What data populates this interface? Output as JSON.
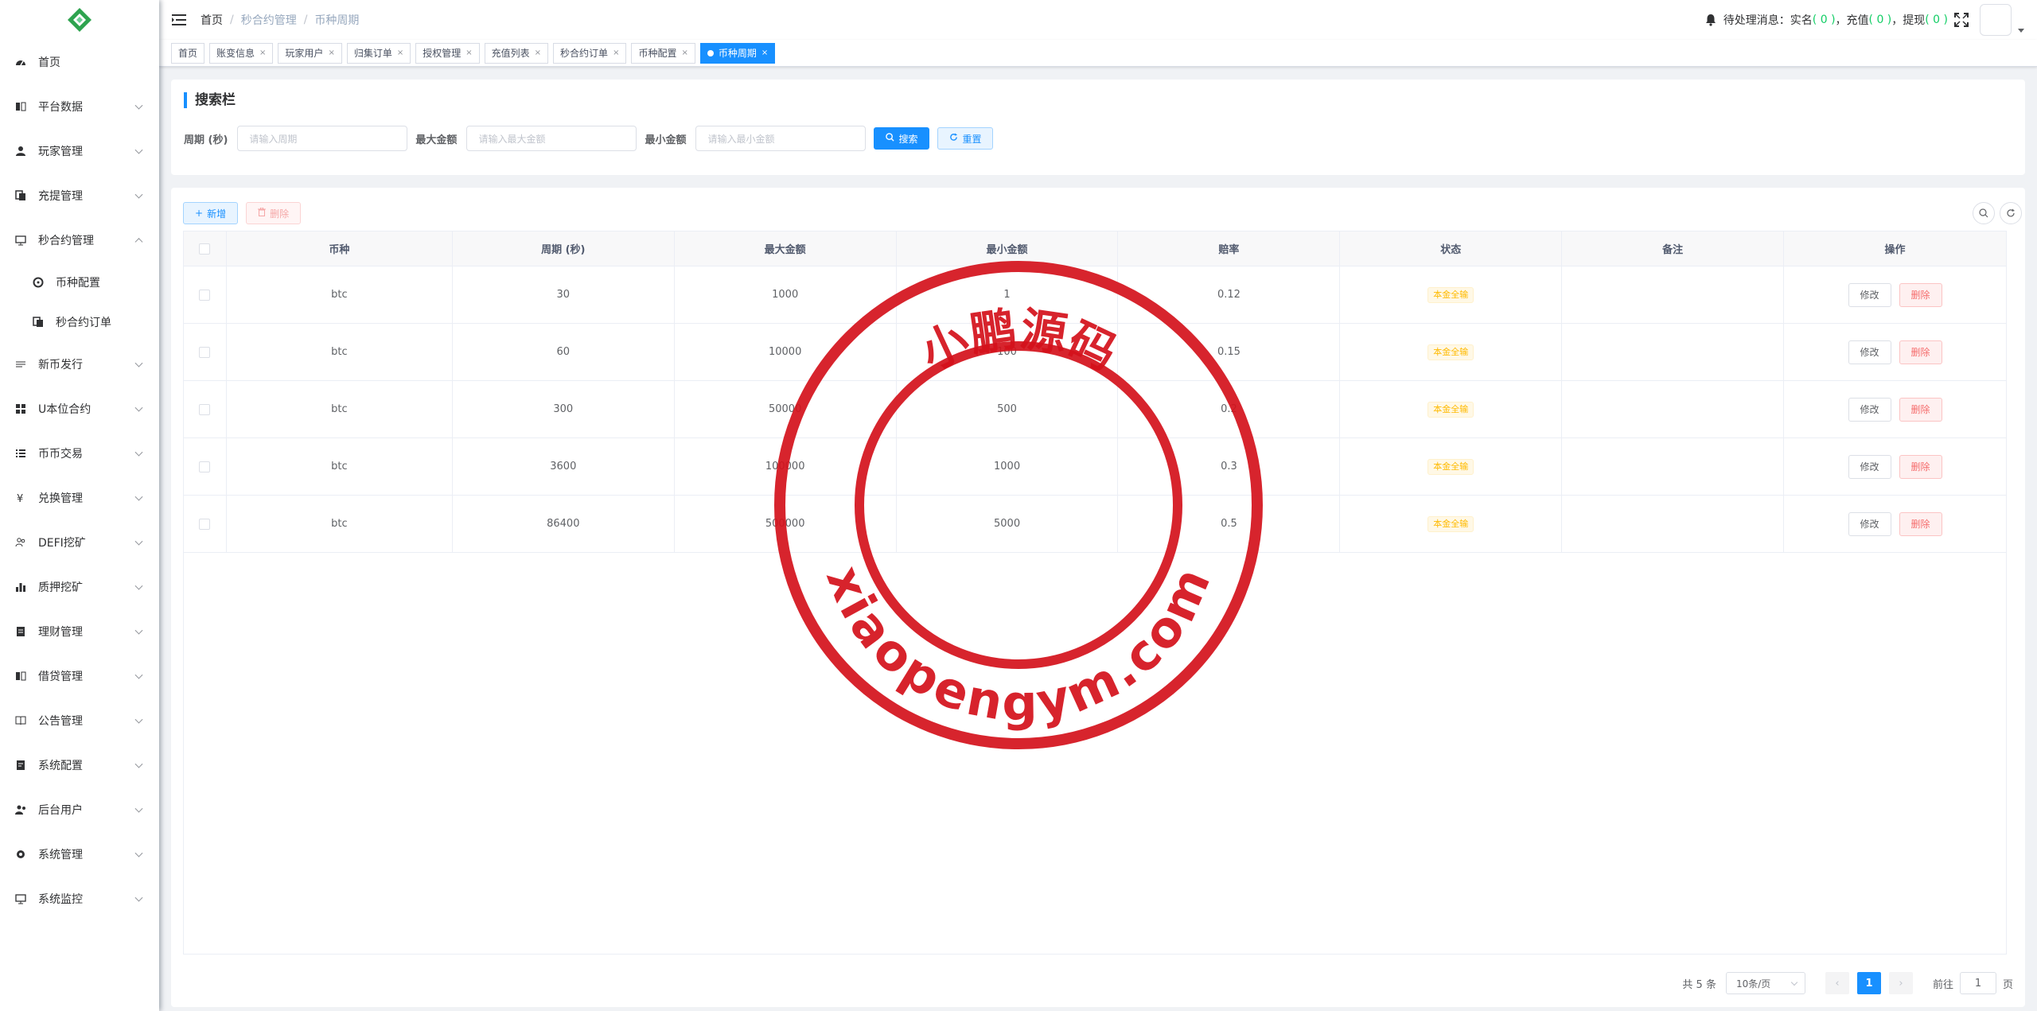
{
  "sidebar": {
    "items": [
      {
        "label": "首页",
        "icon": "dashboard-icon"
      },
      {
        "label": "平台数据",
        "icon": "data-icon"
      },
      {
        "label": "玩家管理",
        "icon": "user-icon"
      },
      {
        "label": "充提管理",
        "icon": "copy-icon"
      },
      {
        "label": "秒合约管理",
        "icon": "monitor-icon"
      },
      {
        "label": "新币发行",
        "icon": "issue-icon"
      },
      {
        "label": "U本位合约",
        "icon": "grid-icon"
      },
      {
        "label": "币币交易",
        "icon": "list-icon"
      },
      {
        "label": "兑换管理",
        "icon": "yen-icon"
      },
      {
        "label": "DEFI挖矿",
        "icon": "people-icon"
      },
      {
        "label": "质押挖矿",
        "icon": "chart-icon"
      },
      {
        "label": "理财管理",
        "icon": "document-icon"
      },
      {
        "label": "借贷管理",
        "icon": "loan-icon"
      },
      {
        "label": "公告管理",
        "icon": "book-icon"
      },
      {
        "label": "系统配置",
        "icon": "config-icon"
      },
      {
        "label": "后台用户",
        "icon": "admin-user-icon"
      },
      {
        "label": "系统管理",
        "icon": "gear-icon"
      },
      {
        "label": "系统监控",
        "icon": "monitor-icon"
      }
    ],
    "submenu": [
      {
        "label": "币种配置",
        "icon": "settings-icon"
      },
      {
        "label": "秒合约订单",
        "icon": "copy-icon"
      }
    ]
  },
  "navbar": {
    "breadcrumb": [
      "首页",
      "秒合约管理",
      "币种周期"
    ],
    "pending_prefix": "待处理消息：实名",
    "pending_realname": "( 0 )",
    "pending_recharge_label": "，充值",
    "pending_recharge": "( 0 )",
    "pending_withdraw_label": "，提现",
    "pending_withdraw": "( 0 )"
  },
  "tags": [
    "首页",
    "账变信息",
    "玩家用户",
    "归集订单",
    "授权管理",
    "充值列表",
    "秒合约订单",
    "币种配置",
    "币种周期"
  ],
  "search": {
    "title": "搜索栏",
    "period_label": "周期 (秒)",
    "period_placeholder": "请输入周期",
    "max_label": "最大金额",
    "max_placeholder": "请输入最大金额",
    "min_label": "最小金额",
    "min_placeholder": "请输入最小金额",
    "search_btn": "搜索",
    "reset_btn": "重置"
  },
  "toolbar": {
    "add_btn": "新增",
    "delete_btn": "删除"
  },
  "table": {
    "headers": [
      "币种",
      "周期 (秒)",
      "最大金额",
      "最小金额",
      "赔率",
      "状态",
      "备注",
      "操作"
    ],
    "rows": [
      {
        "coin": "btc",
        "period": "30",
        "max": "1000",
        "min": "1",
        "rate": "0.12",
        "status": "本金全输",
        "remark": ""
      },
      {
        "coin": "btc",
        "period": "60",
        "max": "10000",
        "min": "100",
        "rate": "0.15",
        "status": "本金全输",
        "remark": ""
      },
      {
        "coin": "btc",
        "period": "300",
        "max": "50000",
        "min": "500",
        "rate": "0.2",
        "status": "本金全输",
        "remark": ""
      },
      {
        "coin": "btc",
        "period": "3600",
        "max": "100000",
        "min": "1000",
        "rate": "0.3",
        "status": "本金全输",
        "remark": ""
      },
      {
        "coin": "btc",
        "period": "86400",
        "max": "500000",
        "min": "5000",
        "rate": "0.5",
        "status": "本金全输",
        "remark": ""
      }
    ],
    "edit_btn": "修改",
    "delete_btn": "删除"
  },
  "pagination": {
    "total": "共 5 条",
    "page_size": "10条/页",
    "current_page": "1",
    "goto_label": "前往",
    "goto_value": "1",
    "page_suffix": "页"
  },
  "watermark": {
    "top_text": "小鹏源码",
    "bottom_text": "xiaopengym.com",
    "color": "#d4111b"
  },
  "colors": {
    "accent": "#1890ff",
    "danger": "#f56c6c",
    "warning": "#ffba00",
    "success": "#13ce66"
  }
}
